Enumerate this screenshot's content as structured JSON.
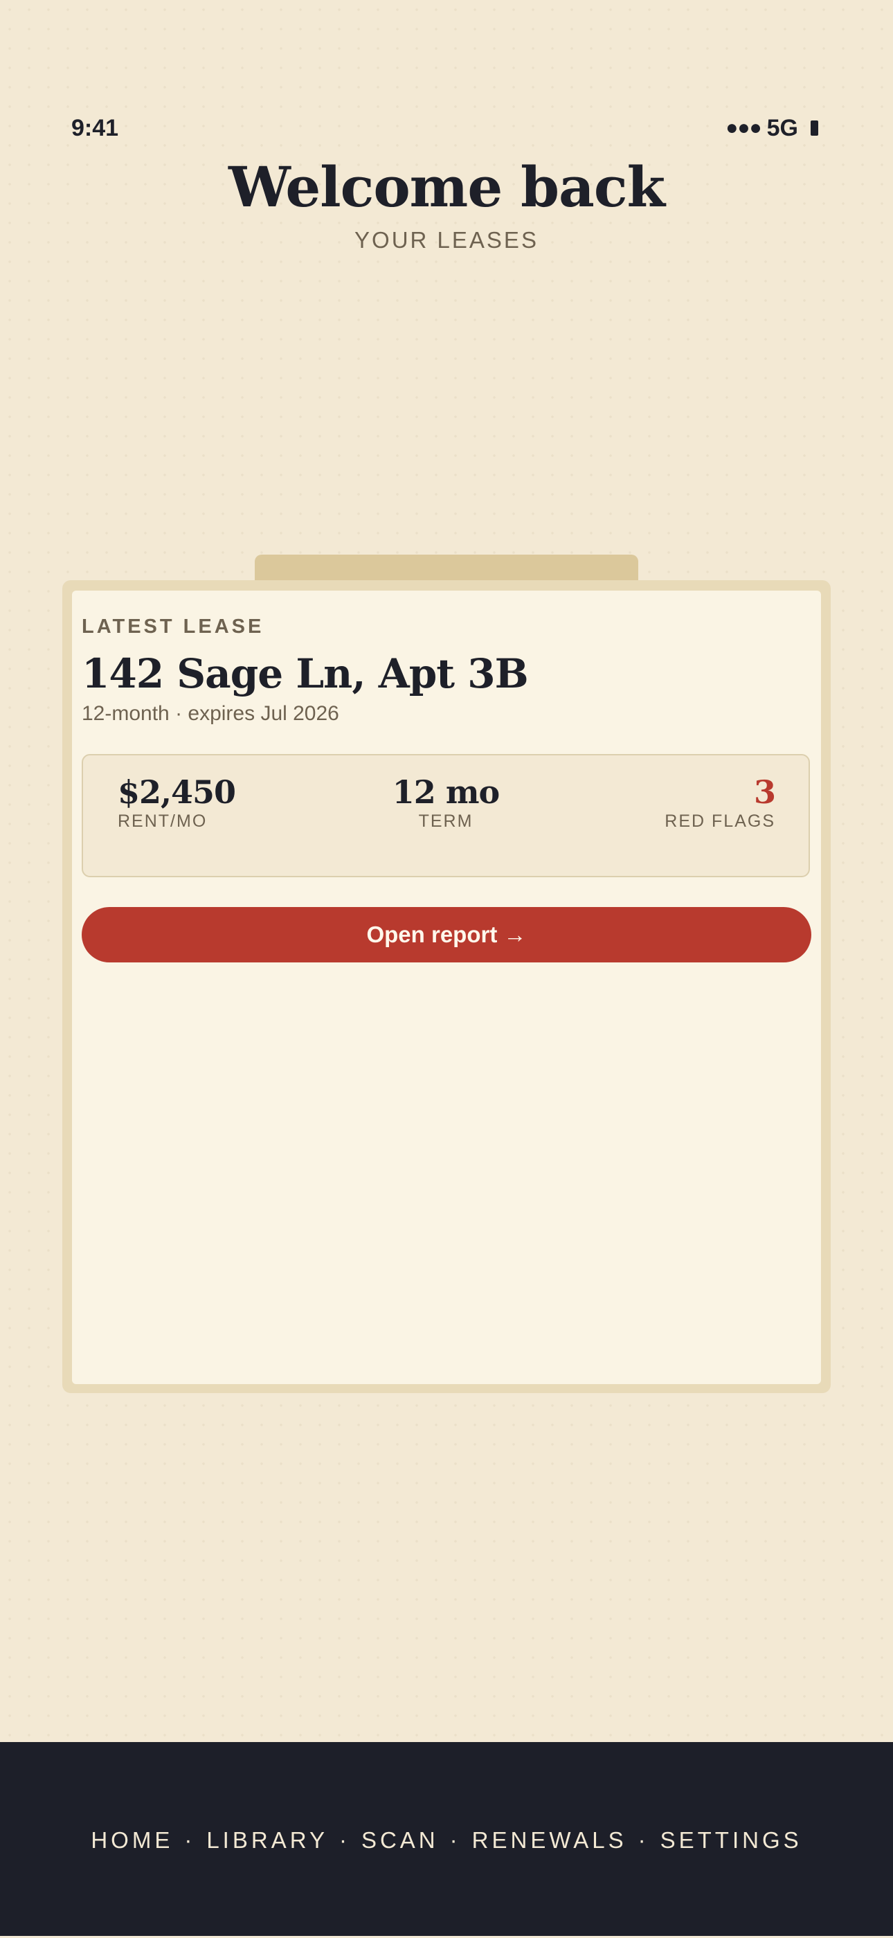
{
  "status_bar": {
    "time": "9:41",
    "signal": "●●●",
    "network": "5G",
    "battery_icon": "battery-icon"
  },
  "header": {
    "title": "Welcome back",
    "subtitle": "YOUR LEASES"
  },
  "lease_card": {
    "eyebrow": "LATEST LEASE",
    "address": "142 Sage Ln, Apt 3B",
    "meta": "12-month · expires Jul 2026",
    "stats": {
      "rent": {
        "value": "$2,450",
        "label": "RENT/MO"
      },
      "term": {
        "value": "12 mo",
        "label": "TERM"
      },
      "red_flags": {
        "value": "3",
        "label": "RED FLAGS"
      }
    },
    "open_report_label": "Open report →"
  },
  "bottom_nav": {
    "items": [
      "HOME",
      "LIBRARY",
      "SCAN",
      "RENEWALS",
      "SETTINGS"
    ],
    "separator": "·"
  },
  "colors": {
    "background": "#f3e9d4",
    "card": "#faf4e4",
    "accent": "#b83a2e",
    "ink": "#1e2029",
    "muted": "#6e6250",
    "nav_background": "#1d1f29"
  }
}
